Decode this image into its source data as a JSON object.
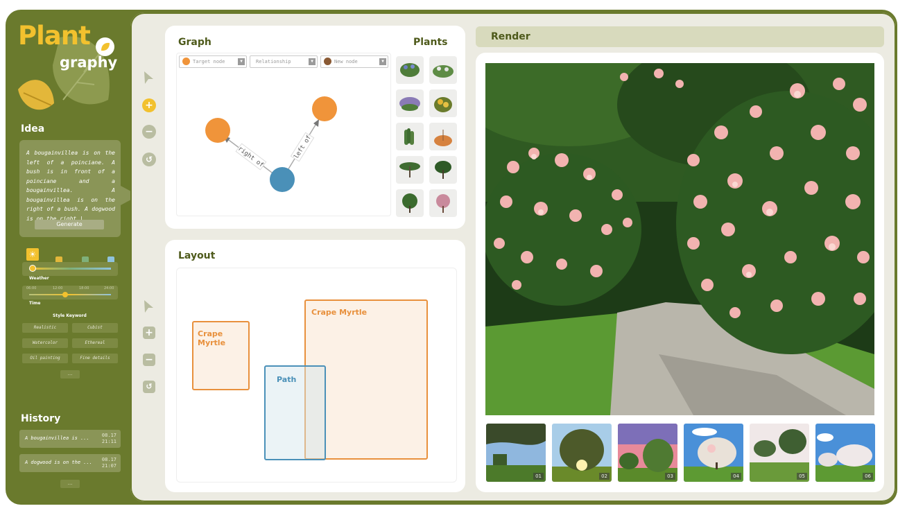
{
  "app": {
    "logo_main": "Plant",
    "logo_sub": "graphy"
  },
  "sidebar": {
    "idea_title": "Idea",
    "idea_text": "A bougainvillea is on the left of a poinciane. A bush is in front of a poinciane and a bougainvillea. A bougainvillea is on the right of a bush. A dogwood is on the right |",
    "generate_label": "Generate",
    "weather_label": "Weather",
    "time_label": "Time",
    "time_ticks": [
      "06:00",
      "12:00",
      "18:00",
      "24:00"
    ],
    "style_title": "Style Keyword",
    "keywords": [
      "Realistic",
      "Cubist",
      "Watercolor",
      "Ethereal",
      "Oil painting",
      "Fine details"
    ],
    "more": "...",
    "history_title": "History",
    "history": [
      {
        "text": "A bougainvillea is ...",
        "date": "08.17",
        "time": "21:11"
      },
      {
        "text": "A dogwood is on the ...",
        "date": "08.17",
        "time": "21:07"
      }
    ]
  },
  "graph": {
    "title": "Graph",
    "plants_title": "Plants",
    "target_placeholder": "Target node",
    "relationship_placeholder": "Relationship",
    "new_node_placeholder": "New node",
    "edge_labels": [
      "right of",
      "left of"
    ]
  },
  "layout": {
    "title": "Layout",
    "boxes": [
      {
        "label": "Crape Myrtle"
      },
      {
        "label": "Crape Myrtle"
      },
      {
        "label": "Path"
      }
    ]
  },
  "render": {
    "title": "Render",
    "thumb_numbers": [
      "01",
      "02",
      "03",
      "04",
      "05",
      "06"
    ]
  },
  "colors": {
    "sidebar": "#6a7a2d",
    "accent": "#f2c12e",
    "node_orange": "#f0943a",
    "node_blue": "#4a90b8"
  }
}
